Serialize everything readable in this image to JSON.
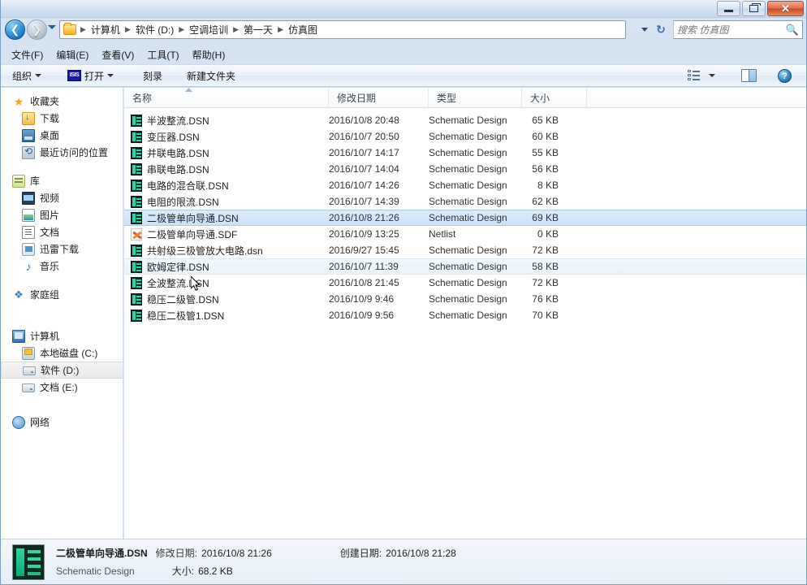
{
  "window": {
    "controls": {
      "minimize": "–",
      "maximize": "❐",
      "close": "✕"
    }
  },
  "address": {
    "back_icon": "back-arrow-icon",
    "forward_icon": "forward-arrow-icon",
    "crumbs": [
      "计算机",
      "软件 (D:)",
      "空调培训",
      "第一天",
      "仿真图"
    ],
    "separator": "▶",
    "refresh_icon": "refresh-icon",
    "dropdown_icon": "chevron-down-icon"
  },
  "search": {
    "placeholder": "搜索 仿真图",
    "icon": "search-icon"
  },
  "menu": [
    {
      "label": "文件(F)"
    },
    {
      "label": "编辑(E)"
    },
    {
      "label": "查看(V)"
    },
    {
      "label": "工具(T)"
    },
    {
      "label": "帮助(H)"
    }
  ],
  "toolbar": {
    "organize": "组织",
    "open": "打开",
    "open_icon_text": "ISIS",
    "burn": "刻录",
    "new_folder": "新建文件夹",
    "view_icon": "view-options-icon",
    "preview_icon": "preview-pane-icon",
    "help_icon": "help-icon"
  },
  "sidebar": {
    "groups": [
      {
        "header": {
          "label": "收藏夹",
          "icon": "star-icon"
        },
        "items": [
          {
            "label": "下载",
            "icon": "downloads-icon"
          },
          {
            "label": "桌面",
            "icon": "desktop-icon"
          },
          {
            "label": "最近访问的位置",
            "icon": "recent-places-icon"
          }
        ]
      },
      {
        "header": {
          "label": "库",
          "icon": "library-icon"
        },
        "items": [
          {
            "label": "视频",
            "icon": "video-icon"
          },
          {
            "label": "图片",
            "icon": "pictures-icon"
          },
          {
            "label": "文档",
            "icon": "documents-icon"
          },
          {
            "label": "迅雷下载",
            "icon": "xunlei-icon"
          },
          {
            "label": "音乐",
            "icon": "music-icon"
          }
        ]
      },
      {
        "header": {
          "label": "家庭组",
          "icon": "homegroup-icon"
        },
        "items": []
      },
      {
        "header": {
          "label": "计算机",
          "icon": "computer-icon"
        },
        "items": [
          {
            "label": "本地磁盘 (C:)",
            "icon": "hard-drive-icon",
            "selected": false
          },
          {
            "label": "软件 (D:)",
            "icon": "drive-icon",
            "selected": true
          },
          {
            "label": "文档 (E:)",
            "icon": "drive-icon",
            "selected": false
          }
        ]
      },
      {
        "header": {
          "label": "网络",
          "icon": "network-icon"
        },
        "items": []
      }
    ]
  },
  "filelist": {
    "columns": [
      "名称",
      "修改日期",
      "类型",
      "大小"
    ],
    "sort_column": "名称",
    "sort_direction": "asc",
    "rows": [
      {
        "name": "半波整流.DSN",
        "date": "2016/10/8 20:48",
        "type": "Schematic Design",
        "size": "65 KB",
        "icon": "dsn-file-icon",
        "state": "normal"
      },
      {
        "name": "变压器.DSN",
        "date": "2016/10/7 20:50",
        "type": "Schematic Design",
        "size": "60 KB",
        "icon": "dsn-file-icon",
        "state": "normal"
      },
      {
        "name": "并联电路.DSN",
        "date": "2016/10/7 14:17",
        "type": "Schematic Design",
        "size": "55 KB",
        "icon": "dsn-file-icon",
        "state": "normal"
      },
      {
        "name": "串联电路.DSN",
        "date": "2016/10/7 14:04",
        "type": "Schematic Design",
        "size": "56 KB",
        "icon": "dsn-file-icon",
        "state": "normal"
      },
      {
        "name": "电路的混合联.DSN",
        "date": "2016/10/7 14:26",
        "type": "Schematic Design",
        "size": "8 KB",
        "icon": "dsn-file-icon",
        "state": "normal"
      },
      {
        "name": "电阻的限流.DSN",
        "date": "2016/10/7 14:39",
        "type": "Schematic Design",
        "size": "62 KB",
        "icon": "dsn-file-icon",
        "state": "normal"
      },
      {
        "name": "二极管单向导通.DSN",
        "date": "2016/10/8 21:26",
        "type": "Schematic Design",
        "size": "69 KB",
        "icon": "dsn-file-icon",
        "state": "selected"
      },
      {
        "name": "二极管单向导通.SDF",
        "date": "2016/10/9 13:25",
        "type": "Netlist",
        "size": "0 KB",
        "icon": "sdf-file-icon",
        "state": "normal"
      },
      {
        "name": "共射级三极管放大电路.dsn",
        "date": "2016/9/27 15:45",
        "type": "Schematic Design",
        "size": "72 KB",
        "icon": "dsn-file-icon",
        "state": "normal"
      },
      {
        "name": "欧姆定律.DSN",
        "date": "2016/10/7 11:39",
        "type": "Schematic Design",
        "size": "58 KB",
        "icon": "dsn-file-icon",
        "state": "hover"
      },
      {
        "name": "全波整流.DSN",
        "date": "2016/10/8 21:45",
        "type": "Schematic Design",
        "size": "72 KB",
        "icon": "dsn-file-icon",
        "state": "normal"
      },
      {
        "name": "稳压二级管.DSN",
        "date": "2016/10/9 9:46",
        "type": "Schematic Design",
        "size": "76 KB",
        "icon": "dsn-file-icon",
        "state": "normal"
      },
      {
        "name": "稳压二极管1.DSN",
        "date": "2016/10/9 9:56",
        "type": "Schematic Design",
        "size": "70 KB",
        "icon": "dsn-file-icon",
        "state": "normal"
      }
    ]
  },
  "statusbar": {
    "icon": "dsn-file-icon-large",
    "file_name": "二极管单向导通.DSN",
    "modified_label": "修改日期:",
    "modified_value": "2016/10/8 21:26",
    "created_label": "创建日期:",
    "created_value": "2016/10/8 21:28",
    "file_type": "Schematic Design",
    "size_label": "大小:",
    "size_value": "68.2 KB"
  },
  "colors": {
    "selection": "#cbe2f8",
    "selection_border": "#a6cdee",
    "close_button": "#c44a22",
    "accent": "#2a8fd8"
  }
}
